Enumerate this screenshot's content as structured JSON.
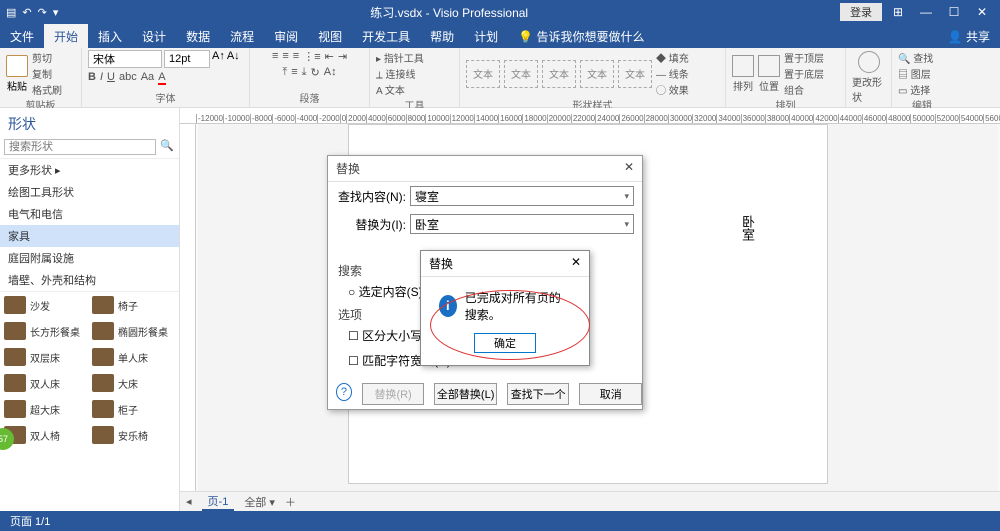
{
  "title": "练习.vsdx - Visio Professional",
  "login": "登录",
  "menus": [
    "文件",
    "开始",
    "插入",
    "设计",
    "数据",
    "流程",
    "审阅",
    "视图",
    "开发工具",
    "帮助",
    "计划"
  ],
  "active_menu": 1,
  "tell_me": "告诉我你想要做什么",
  "share": "共享",
  "clipboard": {
    "cut": "剪切",
    "copy": "复制",
    "fmt": "格式刷",
    "paste": "粘贴",
    "label": "剪贴板"
  },
  "font": {
    "name": "宋体",
    "size": "12pt",
    "label": "字体"
  },
  "para_label": "段落",
  "tools": {
    "pointer": "指针工具",
    "connector": "连接线",
    "text": "文本",
    "label": "工具"
  },
  "shapestyle_label": "形状样式",
  "shapestyle_item": "文本",
  "fill": {
    "fill": "填充",
    "line": "线条",
    "effect": "效果"
  },
  "arrange": {
    "arrange": "排列",
    "position": "位置",
    "bringfront": "置于顶层",
    "sendback": "置于底层",
    "group": "组合",
    "label": "排列"
  },
  "change_shape": "更改形状",
  "edit": {
    "find": "查找",
    "layers": "图层",
    "select": "选择",
    "label": "编辑"
  },
  "sidebar": {
    "title": "形状",
    "search_placeholder": "搜索形状",
    "cats": [
      "更多形状  ▸",
      "绘图工具形状",
      "电气和电信",
      "家具",
      "庭园附属设施",
      "墙壁、外壳和结构"
    ],
    "active_cat": 3,
    "shapes": [
      [
        "沙发",
        "椅子"
      ],
      [
        "长方形餐桌",
        "椭圆形餐桌"
      ],
      [
        "双层床",
        "单人床"
      ],
      [
        "双人床",
        "大床"
      ],
      [
        "超大床",
        "柜子"
      ],
      [
        "双人椅",
        "安乐椅"
      ]
    ]
  },
  "canvas_text": "卧室",
  "page_tab": "页-1",
  "page_all": "全部 ▾",
  "status": "页面 1/1",
  "replace_dialog": {
    "title": "替换",
    "find_label": "查找内容(N):",
    "find_value": "寝室",
    "replace_label": "替换为(I):",
    "replace_value": "卧室",
    "search_section": "搜索",
    "radio_selection": "选定内容(S)",
    "options_section": "选项",
    "cb_case": "区分大小写(C)",
    "cb_width": "匹配字符宽度(D)",
    "btn_replace": "替换(R)",
    "btn_replace_all": "全部替换(L)",
    "btn_find_next": "查找下一个",
    "btn_cancel": "取消"
  },
  "msgbox": {
    "title": "替换",
    "text": "已完成对所有页的搜索。",
    "ok": "确定"
  },
  "bubble": "57"
}
